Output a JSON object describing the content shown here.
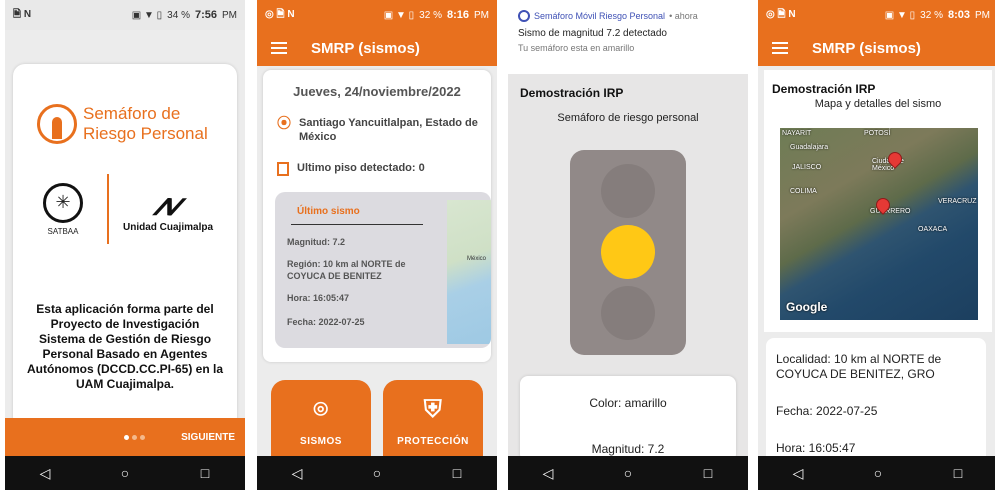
{
  "colors": {
    "brand_orange": "#e8701e",
    "light_yellow": "#ffc815",
    "light_off": "#857d7c",
    "traffic_body": "#918988"
  },
  "screen1": {
    "status": {
      "left_icons": "🗎 N",
      "right_icons": "▣ ▼ ▯",
      "battery": "34 %",
      "time": "7:56",
      "ampm": "PM"
    },
    "logo_line1": "Semáforo de",
    "logo_line2": "Riesgo Personal",
    "partner1": "SATBAA",
    "partner2": "Unidad Cuajimalpa",
    "description": "Esta aplicación forma parte del Proyecto de Investigación Sistema de Gestión de Riesgo Personal Basado en Agentes Autónomos (DCCD.CC.PI-65) en la UAM Cuajimalpa.",
    "next_label": "SIGUIENTE"
  },
  "screen2": {
    "status": {
      "left_icons": "◎ 🗎 N",
      "right_icons": "▣ ▼ ▯",
      "battery": "32 %",
      "time": "8:16",
      "ampm": "PM"
    },
    "app_title": "SMRP (sismos)",
    "date": "Jueves, 24/noviembre/2022",
    "location": "Santiago Yancuitlalpan, Estado de México",
    "floor": "Ultimo piso detectado: 0",
    "last_quake": {
      "title": "Último sismo",
      "magnitude": "Magnitud: 7.2",
      "region": "Región: 10 km al NORTE de COYUCA DE BENITEZ",
      "time": "Hora: 16:05:47",
      "date": "Fecha: 2022-07-25",
      "map_label": "México"
    },
    "tiles": [
      {
        "label": "SISMOS"
      },
      {
        "label": "PROTECCIÓN"
      }
    ]
  },
  "screen3": {
    "notification": {
      "app": "Semáforo Móvil Riesgo Personal",
      "ago": "• ahora",
      "message": "Sismo de magnitud 7.2 detectado",
      "sub": "Tu semáforo esta en amarillo"
    },
    "title": "Demostración IRP",
    "subtitle": "Semáforo de riesgo personal",
    "color": "Color: amarillo",
    "magnitude": "Magnitud: 7.2"
  },
  "screen4": {
    "status": {
      "left_icons": "◎ 🗎 N",
      "right_icons": "▣ ▼ ▯",
      "battery": "32 %",
      "time": "8:03",
      "ampm": "PM"
    },
    "app_title": "SMRP (sismos)",
    "title": "Demostración IRP",
    "subtitle": "Mapa y detalles del sismo",
    "map_labels": [
      "NAYARIT",
      "POTOSÍ",
      "Guadalajara",
      "JALISCO",
      "Ciudad de México",
      "COLIMA",
      "GUERRERO",
      "VERACRUZ",
      "OAXACA"
    ],
    "map_credit": "Google",
    "locality": "Localidad: 10 km al NORTE de COYUCA DE BENITEZ, GRO",
    "date": "Fecha: 2022-07-25",
    "time": "Hora: 16:05:47"
  },
  "nav": {
    "back": "◁",
    "home": "○",
    "recents": "□"
  }
}
